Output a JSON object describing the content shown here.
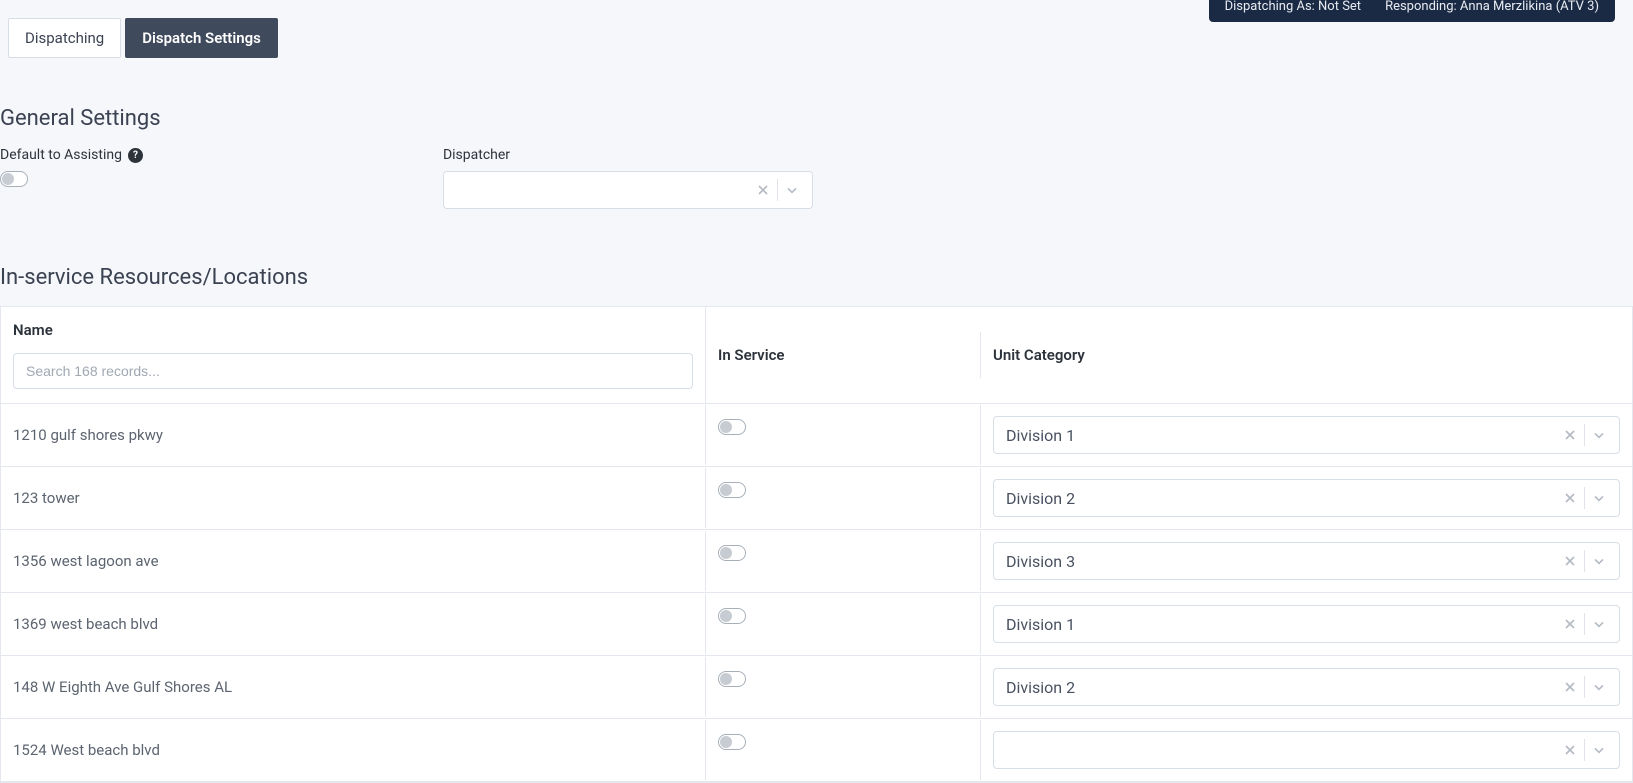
{
  "status_bar": {
    "dispatching_as": "Dispatching As: Not Set",
    "responding": "Responding: Anna Merzlikina (ATV 3)"
  },
  "tabs": {
    "dispatching": "Dispatching",
    "dispatch_settings": "Dispatch Settings"
  },
  "sections": {
    "general_settings": "General Settings",
    "in_service": "In-service Resources/Locations"
  },
  "general": {
    "default_to_assisting_label": "Default to Assisting",
    "dispatcher_label": "Dispatcher",
    "dispatcher_value": ""
  },
  "table": {
    "columns": {
      "name": "Name",
      "in_service": "In Service",
      "unit_category": "Unit Category"
    },
    "search_placeholder": "Search 168 records...",
    "rows": [
      {
        "name": "1210 gulf shores pkwy",
        "in_service": false,
        "unit_category": "Division 1"
      },
      {
        "name": "123 tower",
        "in_service": false,
        "unit_category": "Division 2"
      },
      {
        "name": "1356 west lagoon ave",
        "in_service": false,
        "unit_category": "Division 3"
      },
      {
        "name": "1369 west beach blvd",
        "in_service": false,
        "unit_category": "Division 1"
      },
      {
        "name": "148 W Eighth Ave Gulf Shores AL",
        "in_service": false,
        "unit_category": "Division 2"
      },
      {
        "name": "1524 West beach blvd",
        "in_service": false,
        "unit_category": ""
      }
    ]
  }
}
